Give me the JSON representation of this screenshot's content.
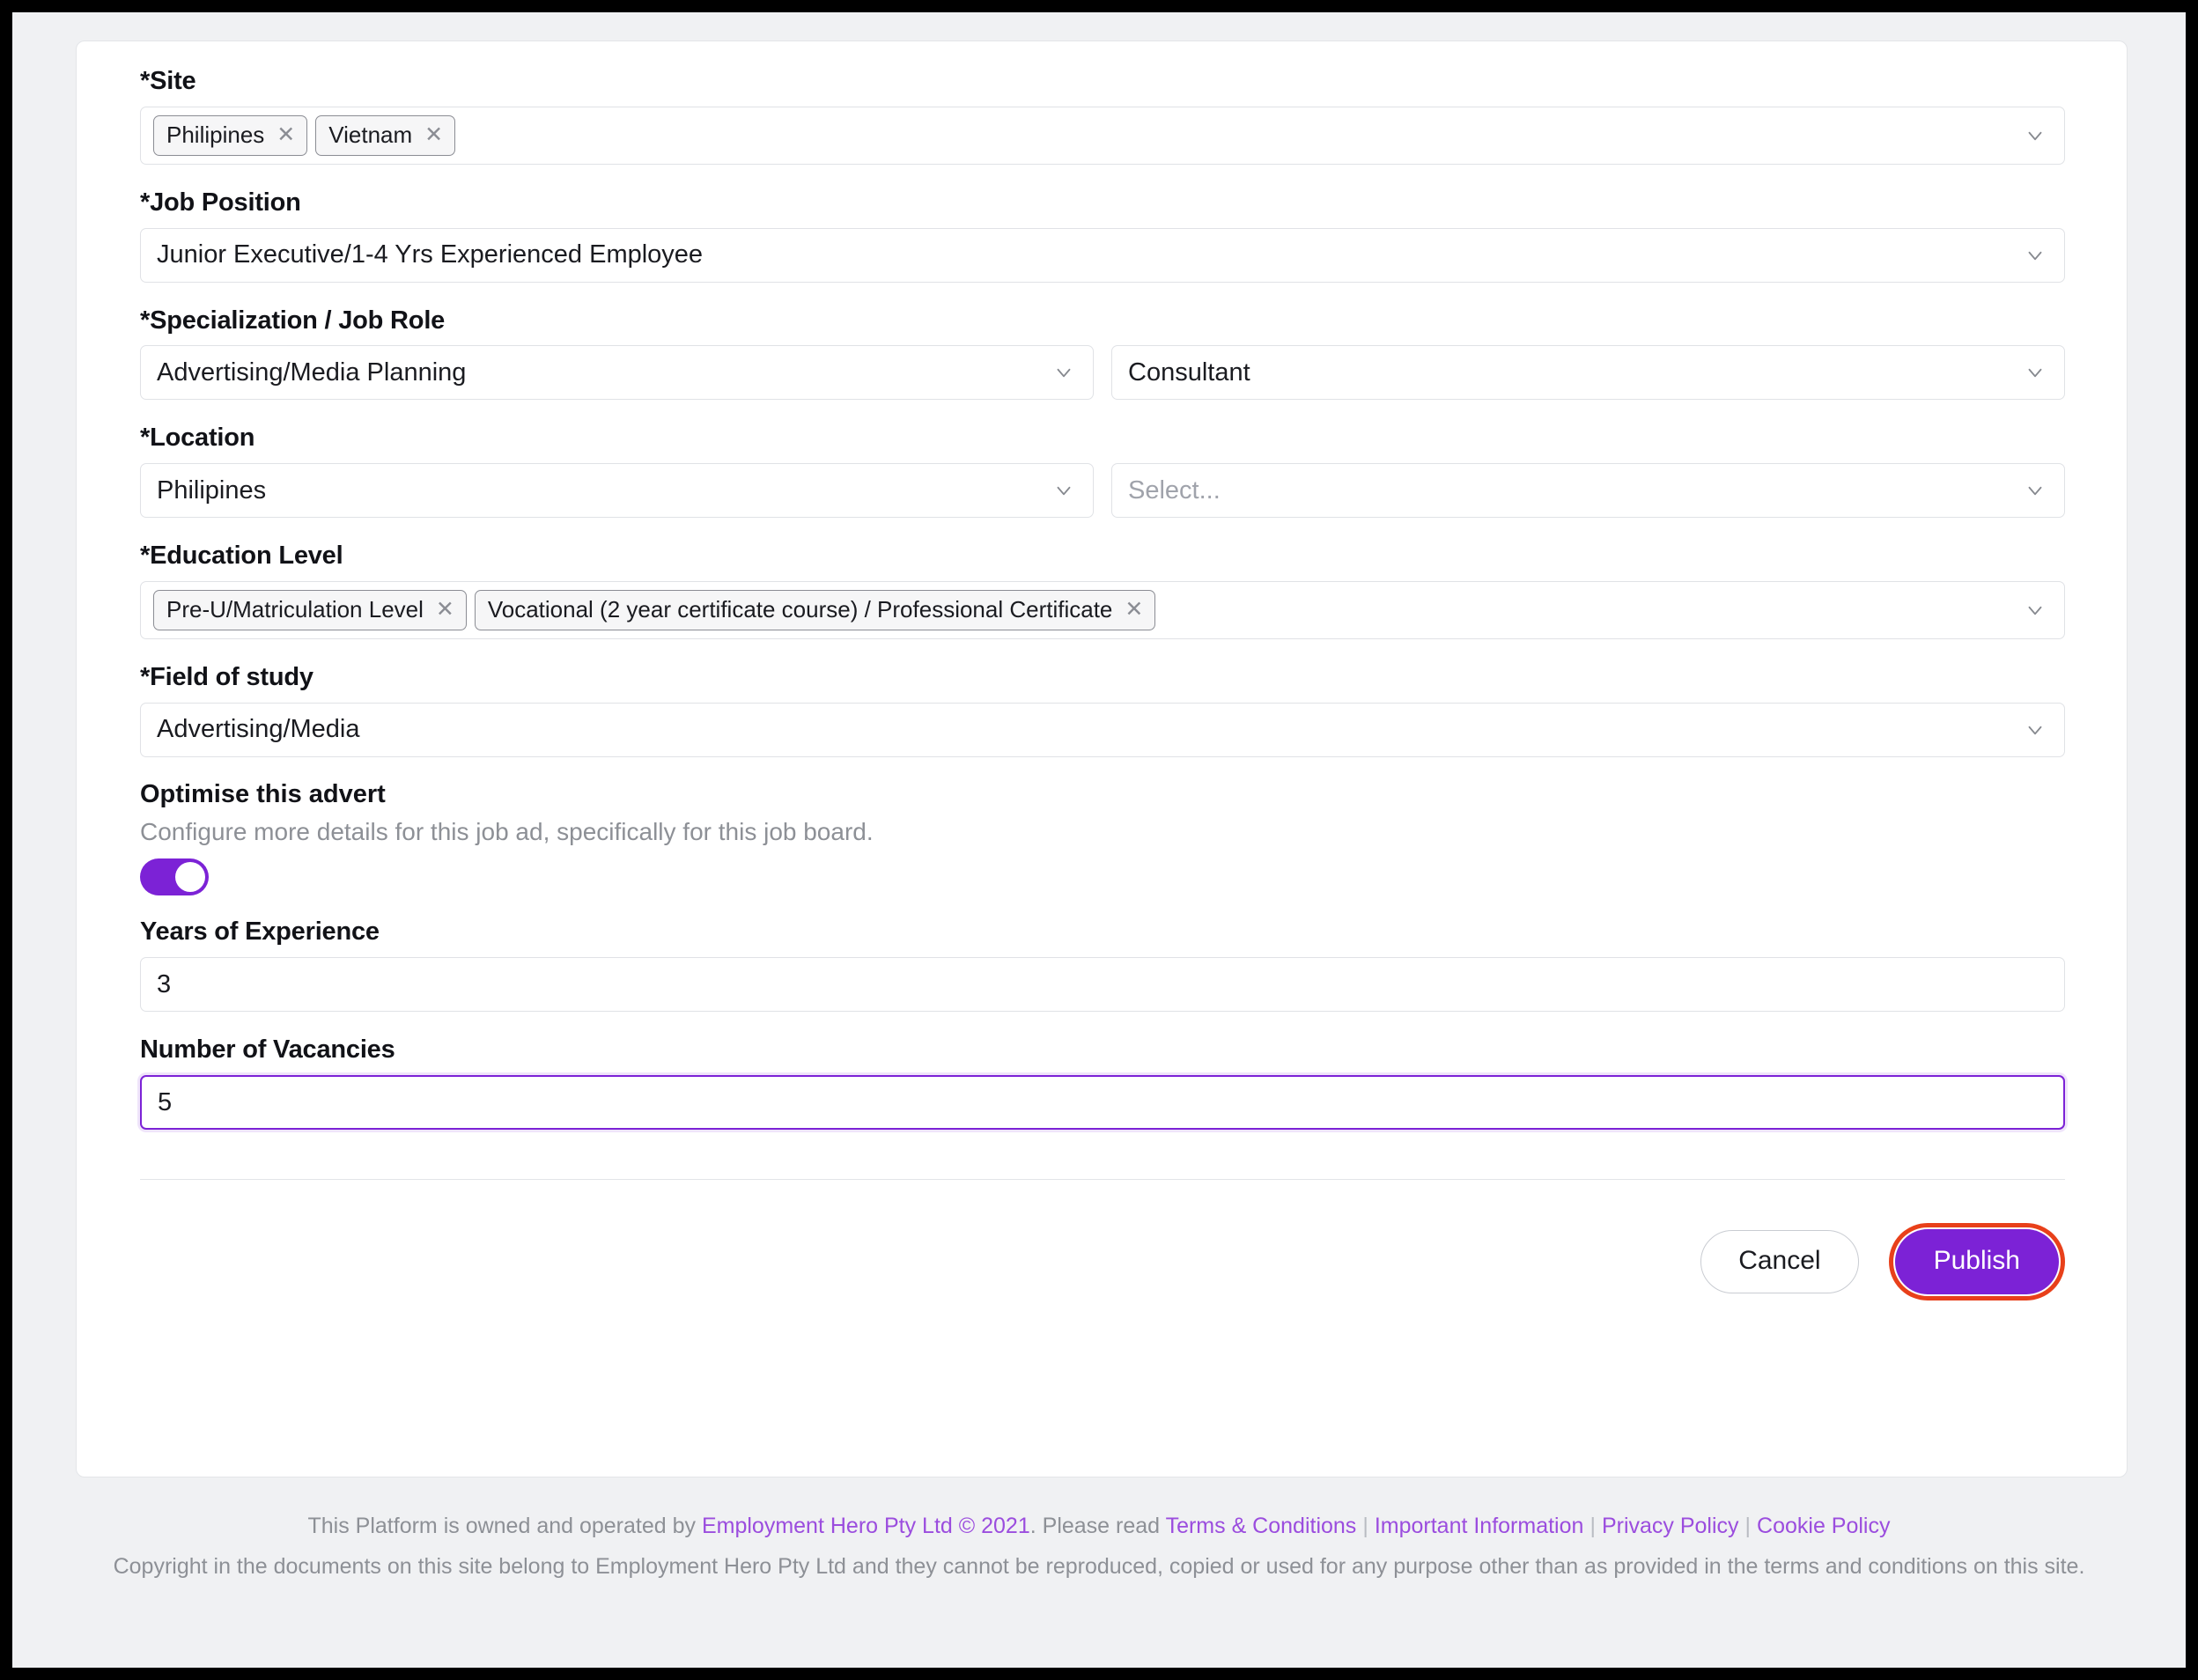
{
  "form": {
    "site": {
      "label": "*Site",
      "tags": [
        "Philipines",
        "Vietnam"
      ],
      "remove_icon": "close-icon",
      "chevron": "chevron-down-icon"
    },
    "job_position": {
      "label": "*Job Position",
      "value": "Junior Executive/1-4 Yrs Experienced Employee"
    },
    "specialization": {
      "label": "*Specialization / Job Role",
      "value": "Advertising/Media Planning",
      "role_value": "Consultant"
    },
    "location": {
      "label": "*Location",
      "value": "Philipines",
      "secondary_placeholder": "Select..."
    },
    "education_level": {
      "label": "*Education Level",
      "tags": [
        "Pre-U/Matriculation Level",
        "Vocational (2 year certificate course) / Professional Certificate"
      ]
    },
    "field_of_study": {
      "label": "*Field of study",
      "value": "Advertising/Media"
    },
    "optimise": {
      "title": "Optimise this advert",
      "description": "Configure more details for this job ad, specifically for this job board.",
      "toggle_state": "on"
    },
    "years_of_experience": {
      "label": "Years of Experience",
      "value": "3"
    },
    "number_of_vacancies": {
      "label": "Number of Vacancies",
      "value": "5",
      "focused": "true"
    }
  },
  "actions": {
    "cancel_label": "Cancel",
    "publish_label": "Publish",
    "publish_highlight_color": "#e8401a",
    "accent_color": "#7c22d6"
  },
  "footer": {
    "line1_prefix": "This Platform is owned and operated by ",
    "company_link": "Employment Hero Pty Ltd © 2021",
    "line1_mid": ". Please read ",
    "links": [
      "Terms & Conditions",
      "Important Information",
      "Privacy Policy",
      "Cookie Policy"
    ],
    "separator": "|",
    "line2": "Copyright in the documents on this site belong to Employment Hero Pty Ltd and they cannot be reproduced, copied or used for any purpose other than as provided in the terms and conditions on this site."
  }
}
